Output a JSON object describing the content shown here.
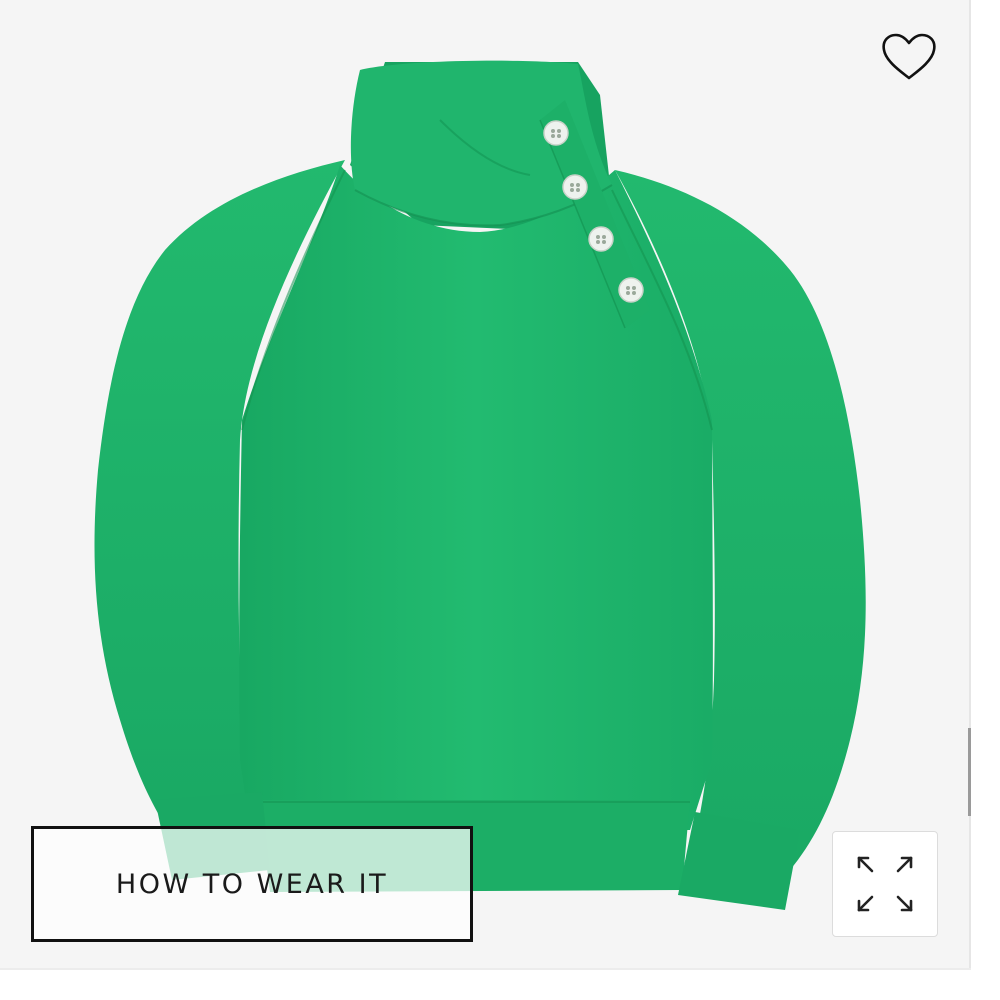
{
  "product_image": {
    "description_icon": "green-mock-neck-button-sweatshirt",
    "colors": {
      "body": "#1fb56b",
      "body_shadow": "#169a59",
      "button": "#eef2ee",
      "background": "#f5f5f5"
    }
  },
  "favorite": {
    "icon": "heart-outline-icon"
  },
  "how_to_wear": {
    "label": "HOW TO WEAR IT"
  },
  "expand": {
    "icon": "expand-arrows-icon"
  }
}
